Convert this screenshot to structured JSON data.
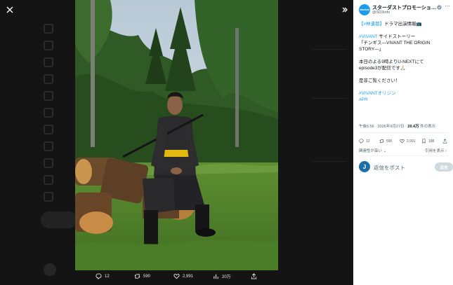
{
  "media_actions": {
    "replies": "12",
    "reposts": "590",
    "likes": "2,991",
    "views": "20万"
  },
  "post": {
    "author_name": "スターダストプロモーショ…",
    "author_handle": "@SD3info",
    "avatar_text": "stardust",
    "lines": [
      {
        "tag": "【#林遣都】",
        "text": "ドラマ出演情報📺"
      },
      {
        "tag": "#VIVANT",
        "text": " サイドストーリー"
      },
      {
        "tag": "",
        "text": "「チンギス―VIVANT THE ORIGIN"
      },
      {
        "tag": "",
        "text": "STORY―」"
      },
      {
        "tag": "",
        "text": "本日のよる9時よりU-NEXTにて"
      },
      {
        "tag": "",
        "text": "episode3が配信です🙏🏻"
      },
      {
        "tag": "",
        "text": "是非ご覧ください！"
      },
      {
        "tag": "#VIVANTオリジン",
        "text": ""
      },
      {
        "tag": "#PR",
        "text": ""
      }
    ],
    "meta_time": "午後6:56 · 2026年9月27日 · ",
    "meta_views": "20.4万",
    "meta_views_label": " 件の表示",
    "stats": {
      "replies": "12",
      "reposts": "590",
      "likes": "2,991",
      "bookmarks": "188"
    },
    "related_link": "関連性が高い ⌄",
    "settings_link": "引用を表示 ›",
    "reply_placeholder": "返信をポスト",
    "reply_button": "返信",
    "reply_avatar_letter": "J"
  },
  "colors": {
    "accent": "#1d9bf0",
    "overlay_bg": "#0b0b0b"
  }
}
